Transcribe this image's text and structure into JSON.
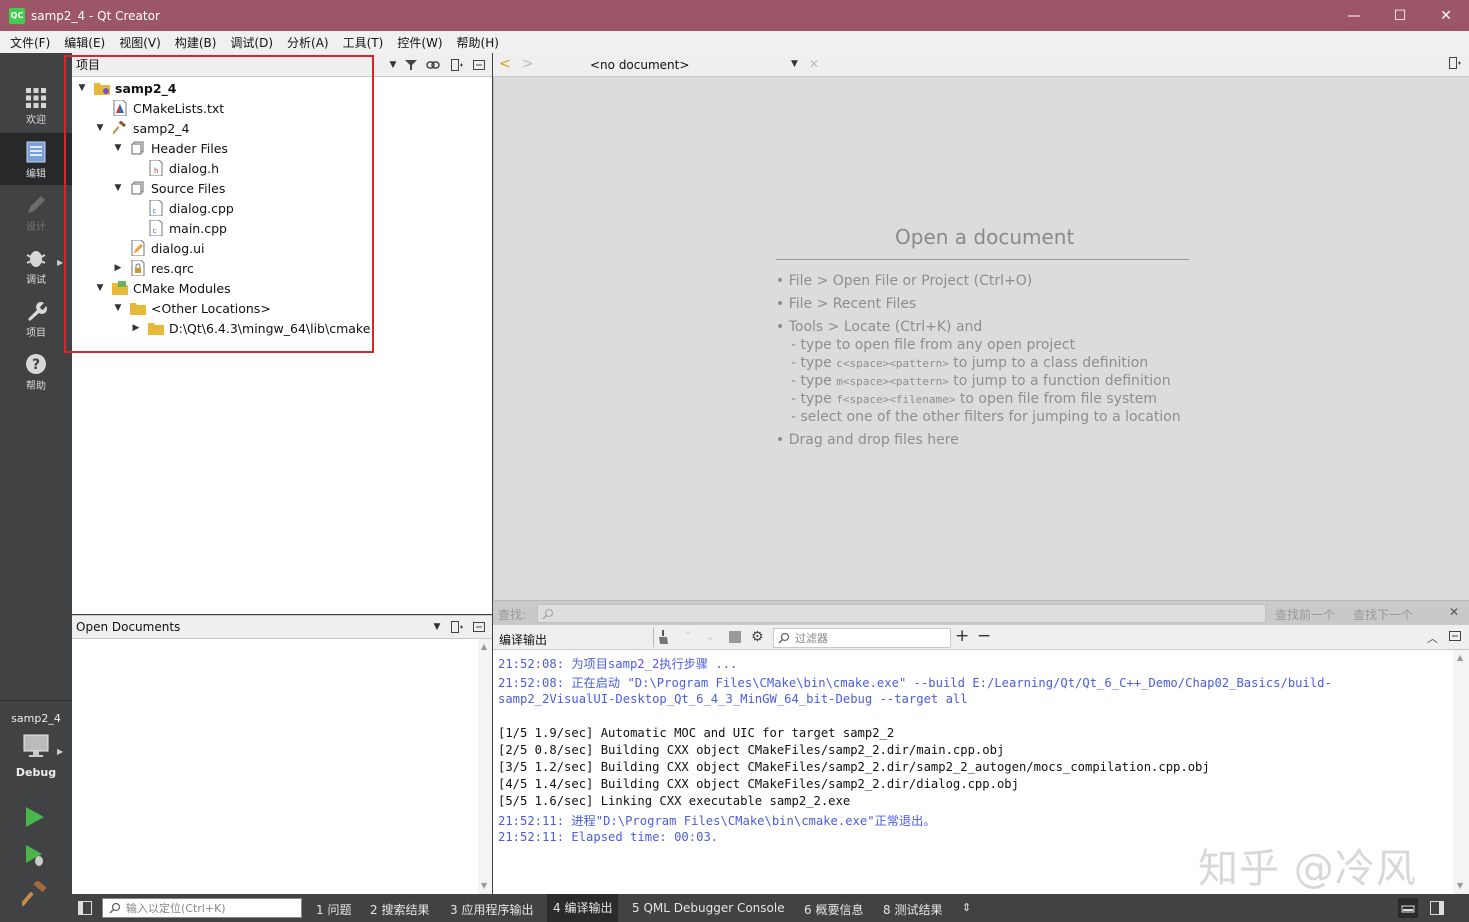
{
  "window": {
    "title": "samp2_4 - Qt Creator",
    "app_icon": "QC"
  },
  "menu": [
    "文件(F)",
    "编辑(E)",
    "视图(V)",
    "构建(B)",
    "调试(D)",
    "分析(A)",
    "工具(T)",
    "控件(W)",
    "帮助(H)"
  ],
  "modes": [
    {
      "label": "欢迎",
      "icon": "grid-icon"
    },
    {
      "label": "编辑",
      "icon": "edit-icon"
    },
    {
      "label": "设计",
      "icon": "pencil-icon"
    },
    {
      "label": "调试",
      "icon": "bug-icon"
    },
    {
      "label": "项目",
      "icon": "wrench-icon"
    },
    {
      "label": "帮助",
      "icon": "help-icon"
    }
  ],
  "kit": {
    "project": "samp2_4",
    "config": "Debug"
  },
  "project_panel": {
    "header": "项目",
    "tree": [
      {
        "label": "samp2_4"
      },
      {
        "label": "CMakeLists.txt"
      },
      {
        "label": "samp2_4"
      },
      {
        "label": "Header Files"
      },
      {
        "label": "dialog.h"
      },
      {
        "label": "Source Files"
      },
      {
        "label": "dialog.cpp"
      },
      {
        "label": "main.cpp"
      },
      {
        "label": "dialog.ui"
      },
      {
        "label": "res.qrc"
      },
      {
        "label": "CMake Modules"
      },
      {
        "label": "<Other Locations>"
      },
      {
        "label": "D:\\Qt\\6.4.3\\mingw_64\\lib\\cmake"
      }
    ]
  },
  "open_documents": {
    "header": "Open Documents"
  },
  "editor": {
    "document_combo": "<no document>",
    "open_title": "Open a document",
    "hints": [
      "• File > Open File or Project (Ctrl+O)",
      "• File > Recent Files",
      "• Tools > Locate (Ctrl+K) and",
      "- type to open file from any open project",
      "- type ",
      "<space><pattern>",
      " to jump to a class definition",
      "- type ",
      "<space><pattern>",
      " to jump to a function definition",
      "- type ",
      "<space><filename>",
      " to open file from file system",
      "- select one of the other filters for jumping to a location",
      "• Drag and drop files here",
      "c",
      "m",
      "f"
    ]
  },
  "find": {
    "label": "查找:",
    "prev": "查找前一个",
    "next": "查找下一个"
  },
  "compile_output": {
    "header": "编译输出",
    "filter_placeholder": "过滤器",
    "lines": [
      {
        "text": "21:52:08: 为项目samp2_2执行步骤 ...",
        "color": "blue"
      },
      {
        "text": "21:52:08: 正在启动 \"D:\\Program Files\\CMake\\bin\\cmake.exe\" --build E:/Learning/Qt/Qt_6_C++_Demo/Chap02_Basics/build-",
        "color": "blue"
      },
      {
        "text": "samp2_2VisualUI-Desktop_Qt_6_4_3_MinGW_64_bit-Debug --target all",
        "color": "blue"
      },
      {
        "text": "[1/5 1.9/sec] Automatic MOC and UIC for target samp2_2",
        "color": "black"
      },
      {
        "text": "[2/5 0.8/sec] Building CXX object CMakeFiles/samp2_2.dir/main.cpp.obj",
        "color": "black"
      },
      {
        "text": "[3/5 1.2/sec] Building CXX object CMakeFiles/samp2_2.dir/samp2_2_autogen/mocs_compilation.cpp.obj",
        "color": "black"
      },
      {
        "text": "[4/5 1.4/sec] Building CXX object CMakeFiles/samp2_2.dir/dialog.cpp.obj",
        "color": "black"
      },
      {
        "text": "[5/5 1.6/sec] Linking CXX executable samp2_2.exe",
        "color": "black"
      },
      {
        "text": "21:52:11: 进程\"D:\\Program Files\\CMake\\bin\\cmake.exe\"正常退出。",
        "color": "blue"
      },
      {
        "text": "21:52:11: Elapsed time: 00:03.",
        "color": "blue"
      }
    ]
  },
  "status": {
    "locator_placeholder": "输入以定位(Ctrl+K)",
    "tabs": [
      "1 问题",
      "2 搜索结果",
      "3 应用程序输出",
      "4 编译输出",
      "5 QML Debugger Console",
      "6 概要信息",
      "8 测试结果"
    ]
  },
  "watermark": "知乎 @冷风",
  "colors": {
    "titlebar": "#9c5667",
    "highlight_box": "#d9232d",
    "output_blue": "#4a5de0"
  }
}
